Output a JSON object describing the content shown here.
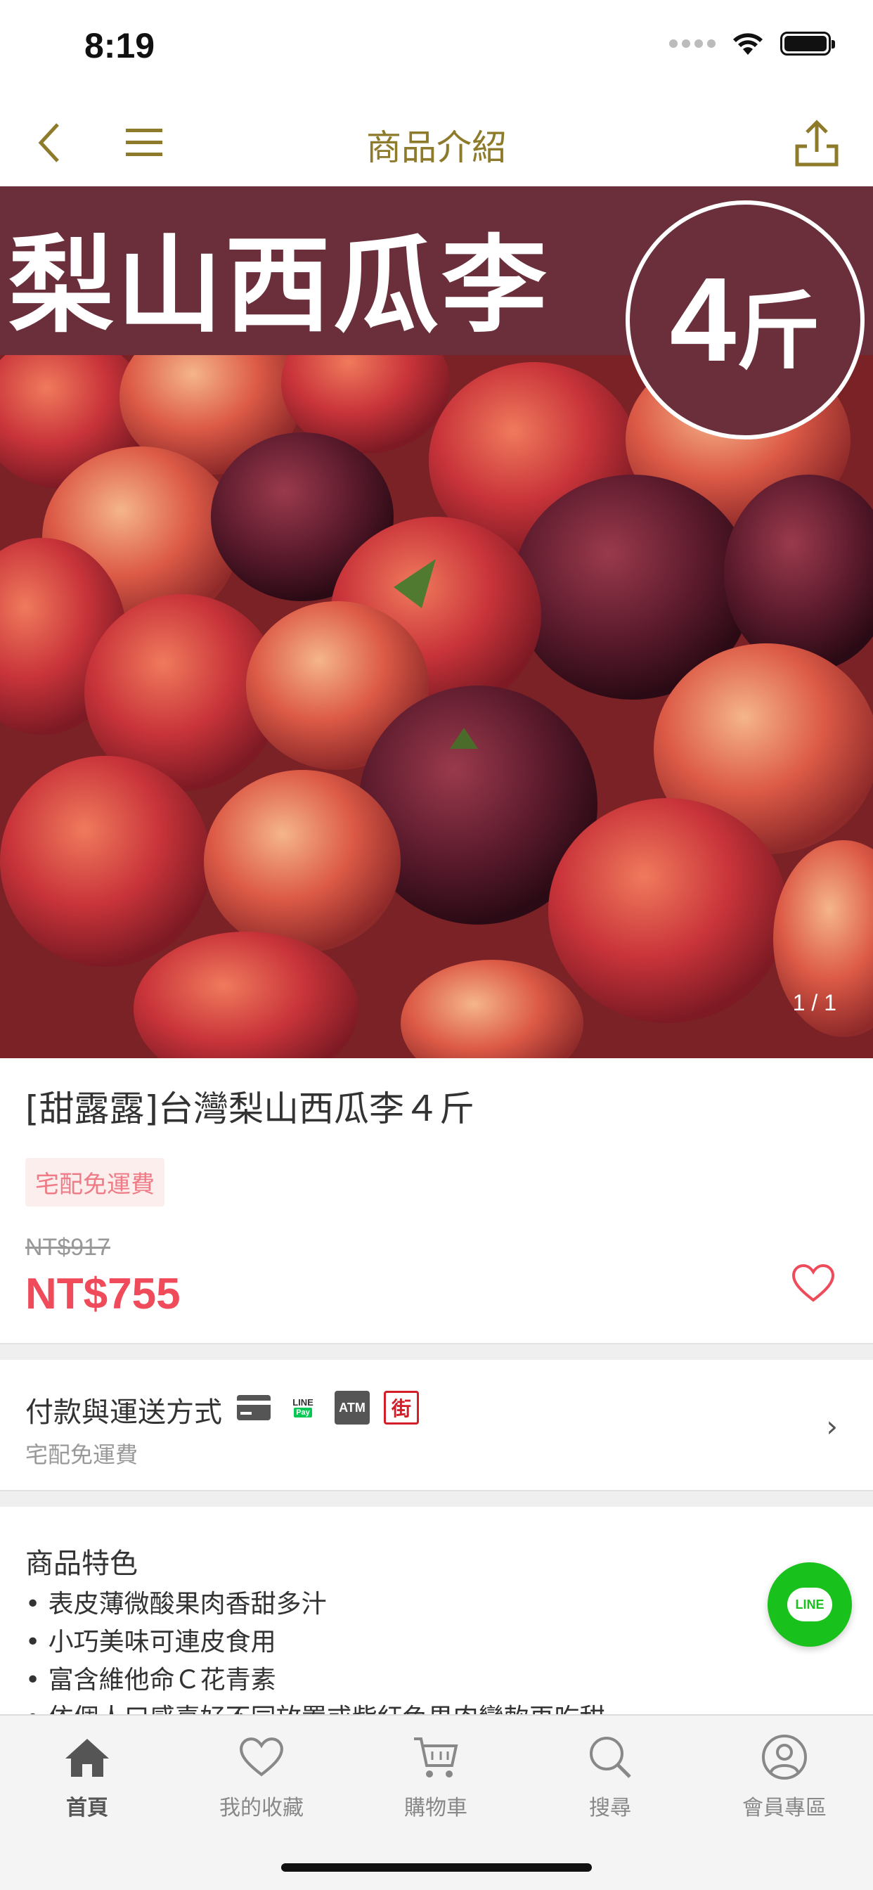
{
  "status_bar": {
    "time": "8:19"
  },
  "nav": {
    "title": "商品介紹"
  },
  "hero": {
    "banner_text": "梨山西瓜李",
    "circle_number": "4",
    "circle_unit": "斤",
    "counter": "1 / 1"
  },
  "product": {
    "title": "[甜露露]台灣梨山西瓜李４斤",
    "tag": "宅配免運費",
    "original_price": "NT$917",
    "sale_price": "NT$755"
  },
  "payment": {
    "title": "付款與運送方式",
    "subtitle": "宅配免運費",
    "icons": [
      "credit-card-icon",
      "line-pay-icon",
      "atm-icon",
      "store-icon"
    ],
    "line_pay_label_top": "LINE",
    "line_pay_label_bottom": "Pay",
    "atm_label": "ATM",
    "store_label": "街"
  },
  "features": {
    "title": "商品特色",
    "items": [
      "• 表皮薄微酸果肉香甜多汁",
      "• 小巧美味可連皮食用",
      "• 富含維他命Ｃ花青素",
      "• 依個人口感喜好不同放置或紫紅色果肉變軟再吃甜"
    ]
  },
  "line_button": {
    "label": "LINE"
  },
  "tabs": [
    {
      "label": "首頁",
      "icon": "home-icon",
      "active": true
    },
    {
      "label": "我的收藏",
      "icon": "heart-icon",
      "active": false
    },
    {
      "label": "購物車",
      "icon": "cart-icon",
      "active": false
    },
    {
      "label": "搜尋",
      "icon": "search-icon",
      "active": false
    },
    {
      "label": "會員專區",
      "icon": "user-icon",
      "active": false
    }
  ],
  "colors": {
    "brand_gold": "#8d7a2a",
    "price_red": "#ef4b5b",
    "banner_maroon": "#6a2f3b",
    "line_green": "#18c11b"
  }
}
